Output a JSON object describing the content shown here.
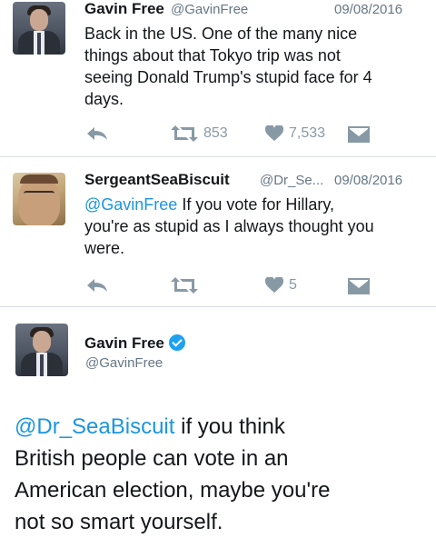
{
  "tweet1": {
    "name": "Gavin Free",
    "handle": "@GavinFree",
    "date": "09/08/2016",
    "text_lines": [
      "Back in the US. One of the many nice",
      "things about that Tokyo trip was not",
      "seeing Donald Trump's stupid face for 4",
      "days."
    ],
    "retweets": "853",
    "likes": "7,533"
  },
  "tweet2": {
    "name": "SergeantSeaBiscuit",
    "handle": "@Dr_Se...",
    "date": "09/08/2016",
    "mention": "@GavinFree",
    "text_line1_rest": " If you vote for Hillary,",
    "text_lines": [
      "you're as stupid as I always thought you",
      "were."
    ],
    "likes": "5"
  },
  "tweet3": {
    "name": "Gavin Free",
    "handle": "@GavinFree",
    "mention": "@Dr_SeaBiscuit",
    "text_line1_rest": " if you think",
    "text_lines": [
      "British people can vote in an",
      "American election, maybe you're",
      "not so smart yourself."
    ]
  },
  "icons": {
    "reply": "reply-icon",
    "retweet": "retweet-icon",
    "like": "heart-icon",
    "dm": "envelope-icon",
    "verified": "verified-badge-icon"
  },
  "colors": {
    "link": "#1b95e0",
    "muted": "#8899a6",
    "verified": "#1da1f2"
  }
}
